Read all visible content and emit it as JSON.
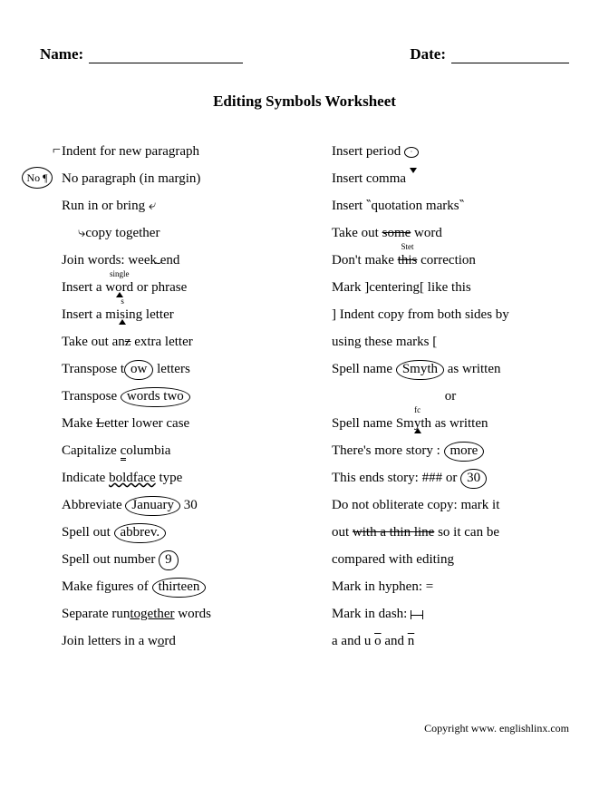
{
  "header": {
    "name_label": "Name:",
    "date_label": "Date:"
  },
  "title": "Editing Symbols Worksheet",
  "left": [
    {
      "pre": "",
      "text": "Indent for new paragraph"
    },
    {
      "margin": "No ¶",
      "text": "No paragraph (in margin)"
    },
    {
      "text": "Run in or bring ⤶"
    },
    {
      "indent": true,
      "text": "⤷copy together"
    },
    {
      "text_a": "Join words: week",
      "close": "  ",
      "text_b": "end"
    },
    {
      "text_a": "Insert a ",
      "caret_text": "word",
      "tick": "single",
      "text_b": " or phrase"
    },
    {
      "text_a": "Insert a mi",
      "caret_text": "s",
      "tick": "s",
      "text_b": "ing letter"
    },
    {
      "text_a": "Take out an",
      "kill": "z",
      "text_b": " extra letter"
    },
    {
      "text_a": "Transpose t",
      "circ": "ow",
      "text_b": " letters"
    },
    {
      "text_a": "Transpose ",
      "circ": "words two"
    },
    {
      "text_a": "Make ",
      "diag": "L",
      "text_b": "etter lower case"
    },
    {
      "text_a": "Capitalize ",
      "tri3": "c",
      "text_b": "olumbia"
    },
    {
      "text_a": "Indicate ",
      "wavy": "boldface",
      "text_b": " type"
    },
    {
      "text_a": "Abbreviate ",
      "circ": "January",
      "text_b": " 30"
    },
    {
      "text_a": "Spell out ",
      "circ": "abbrev."
    },
    {
      "text_a": "Spell out number ",
      "circ": "9"
    },
    {
      "text_a": "Make figures of ",
      "circ": "thirteen"
    },
    {
      "text_a": "Separate run",
      "sep": "together",
      "text_b": " words"
    },
    {
      "text_a": "Join letters in a w",
      "sep": "o",
      "text_b": "rd"
    }
  ],
  "right": [
    {
      "text_a": "Insert period ",
      "tiny": "·"
    },
    {
      "text_a": "Insert comma ",
      "caret_above": true
    },
    {
      "text_a": "Insert ",
      "qm1": "‶",
      "mid": "quotation marks",
      "qm2": "‶"
    },
    {
      "text_a": "Take out ",
      "strike": "some",
      "text_b": " word"
    },
    {
      "text_a": "Don't make ",
      "strike_stet": "this",
      "text_b": " correction",
      "tick": "Stet"
    },
    {
      "text": "Mark ]centering[ like this"
    },
    {
      "text": "] Indent copy from both sides by"
    },
    {
      "text": "using these marks ["
    },
    {
      "text_a": "Spell name ",
      "circ": "Smyth",
      "text_b": " as written"
    },
    {
      "center": "or"
    },
    {
      "text_a": "Spell name Sm",
      "caret_text": "y",
      "tick": "fc",
      "text_b": "th as written"
    },
    {
      "text_a": "There's more story :  ",
      "circ": "more"
    },
    {
      "text_a": "This ends story:  ### or ",
      "circ": "30"
    },
    {
      "text": "Do not obliterate copy: mark it"
    },
    {
      "text_a": "out ",
      "strike": "with a thin line",
      "text_b": " so it can be"
    },
    {
      "text": "compared with editing"
    },
    {
      "text": "Mark in hyphen:  ="
    },
    {
      "text_a": "Mark in dash:  ",
      "dash": "12"
    },
    {
      "text_a": "a and u",
      "gap": "          ",
      "ol1": "o",
      "text_b": " and ",
      "ol2": "n"
    }
  ],
  "footer": "Copyright www. englishlinx.com"
}
